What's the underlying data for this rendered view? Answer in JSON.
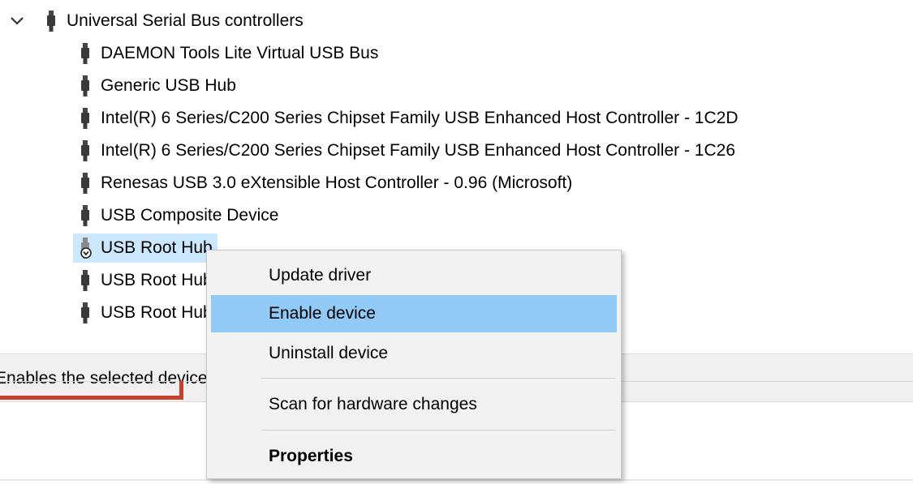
{
  "tree": {
    "category": {
      "label": "Universal Serial Bus controllers",
      "expanded": true,
      "icon": "usb-connector-icon"
    },
    "devices": [
      {
        "label": "DAEMON Tools Lite Virtual USB Bus",
        "icon": "usb-connector-icon"
      },
      {
        "label": "Generic USB Hub",
        "icon": "usb-connector-icon"
      },
      {
        "label": "Intel(R) 6 Series/C200 Series Chipset Family USB Enhanced Host Controller - 1C2D",
        "icon": "usb-connector-icon"
      },
      {
        "label": "Intel(R) 6 Series/C200 Series Chipset Family USB Enhanced Host Controller - 1C26",
        "icon": "usb-connector-icon"
      },
      {
        "label": "Renesas USB 3.0 eXtensible Host Controller - 0.96 (Microsoft)",
        "icon": "usb-connector-icon"
      },
      {
        "label": "USB Composite Device",
        "icon": "usb-connector-icon"
      },
      {
        "label": "USB Root Hub",
        "icon": "usb-disabled-device-icon",
        "selected": true,
        "status": "disabled"
      },
      {
        "label": "USB Root Hub",
        "icon": "usb-connector-icon"
      },
      {
        "label": "USB Root Hub",
        "icon": "usb-connector-icon"
      }
    ]
  },
  "status_bar": {
    "text": "Enables the selected device."
  },
  "context_menu": {
    "items": [
      {
        "label": "Update driver",
        "highlighted": false,
        "bold": false
      },
      {
        "label": "Enable device",
        "highlighted": true,
        "bold": false
      },
      {
        "label": "Uninstall device",
        "highlighted": false,
        "bold": false
      },
      {
        "label": "Scan for hardware changes",
        "highlighted": false,
        "bold": false
      },
      {
        "label": "Properties",
        "highlighted": false,
        "bold": true
      }
    ]
  },
  "colors": {
    "selection": "#cce8ff",
    "menu_highlight": "#91c9f7",
    "menu_background": "#f2f2f2",
    "status_background": "#f0f0f0",
    "accent_red": "#c4422b"
  }
}
